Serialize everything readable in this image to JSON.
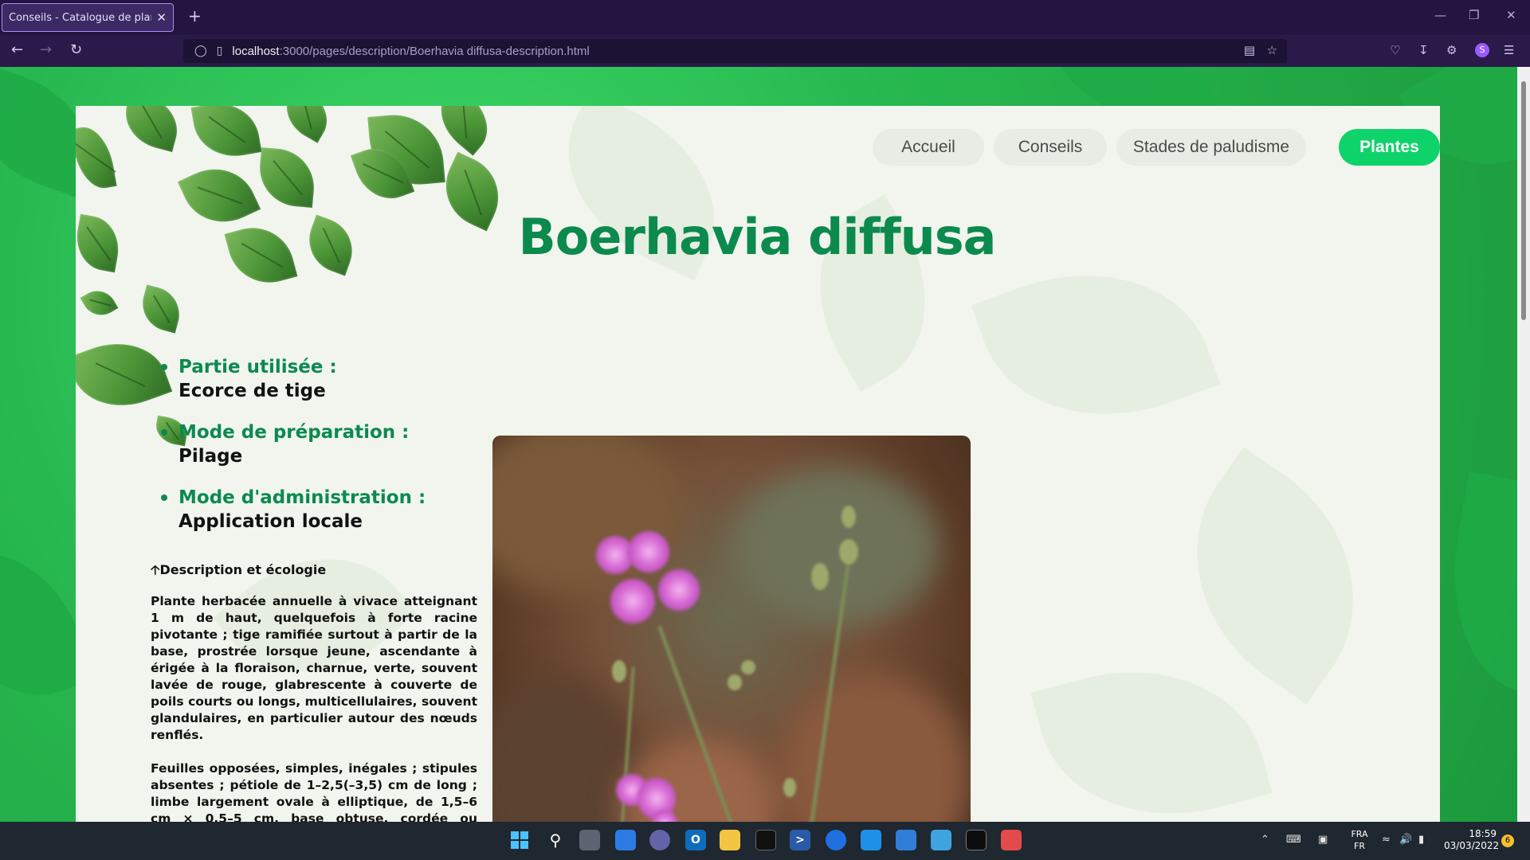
{
  "browser": {
    "tab_title": "Conseils - Catalogue de plantes",
    "tab_close": "✕",
    "new_tab": "+",
    "url_host": "localhost",
    "url_path": ":3000/pages/description/Boerhavia diffusa-description.html",
    "window_controls": [
      "—",
      "❐",
      "✕"
    ]
  },
  "site": {
    "nav": [
      {
        "label": "Accueil",
        "active": false
      },
      {
        "label": "Conseils",
        "active": false
      },
      {
        "label": "Stades de paludisme",
        "active": false
      },
      {
        "label": "Plantes",
        "active": true
      }
    ],
    "title": "Boerhavia diffusa",
    "facts": [
      {
        "label": "Partie utilisée :",
        "value": "Ecorce de tige"
      },
      {
        "label": "Mode de préparation :",
        "value": "Pilage"
      },
      {
        "label": "Mode d'administration :",
        "value": "Application locale"
      }
    ],
    "description_heading": "Description et écologie",
    "description_icon": "arrow-up-icon",
    "description_paragraphs": [
      "Plante herbacée annuelle à vivace atteignant 1 m de haut, quelquefois à forte racine pivotante ; tige ramifiée surtout à partir de la base, prostrée lorsque jeune, ascendante à érigée à la floraison, charnue, verte, souvent lavée de rouge, glabrescente à couverte de poils courts ou longs, multicellulaires, souvent glandulaires, en particulier autour des nœuds renflés.",
      "Feuilles opposées, simples, inégales ; stipules absentes ; pétiole de 1–2,5(–3,5) cm de long ; limbe largement ovale à elliptique, de 1,5–6 cm × 0,5–5 cm, base obtuse, cordée ou tronquée, apex aigu à obtus, bords sinués, vert clair à blanchâtre dessous"
    ],
    "accent_color": "#0c8a4e",
    "active_nav_color": "#0dd36a"
  },
  "taskbar": {
    "language_top": "FRA",
    "language_bottom": "FR",
    "time": "18:59",
    "date": "03/03/2022",
    "notification_count": "6"
  }
}
